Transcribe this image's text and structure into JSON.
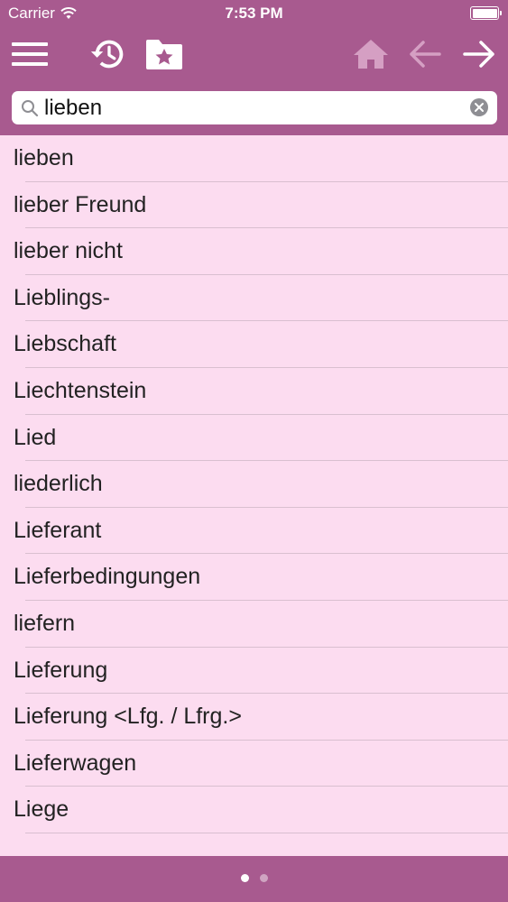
{
  "status_bar": {
    "carrier": "Carrier",
    "time": "7:53 PM"
  },
  "toolbar": {
    "icons": [
      "menu-icon",
      "history-icon",
      "favorites-folder-icon",
      "home-icon",
      "arrow-left-icon",
      "arrow-right-icon"
    ]
  },
  "search": {
    "value": "lieben"
  },
  "results": [
    "lieben",
    "lieber Freund",
    "lieber nicht",
    "Lieblings-",
    "Liebschaft",
    "Liechtenstein",
    "Lied",
    "liederlich",
    "Lieferant",
    "Lieferbedingungen",
    "liefern",
    "Lieferung",
    "Lieferung <Lfg. / Lfrg.>",
    "Lieferwagen",
    "Liege"
  ],
  "pager": {
    "pages": 2,
    "current": 1
  },
  "colors": {
    "bar": "#a85a8f",
    "list_bg": "#fcdcf0",
    "separator": "#d9bfd0",
    "disabled_icon": "#d59fc3"
  }
}
